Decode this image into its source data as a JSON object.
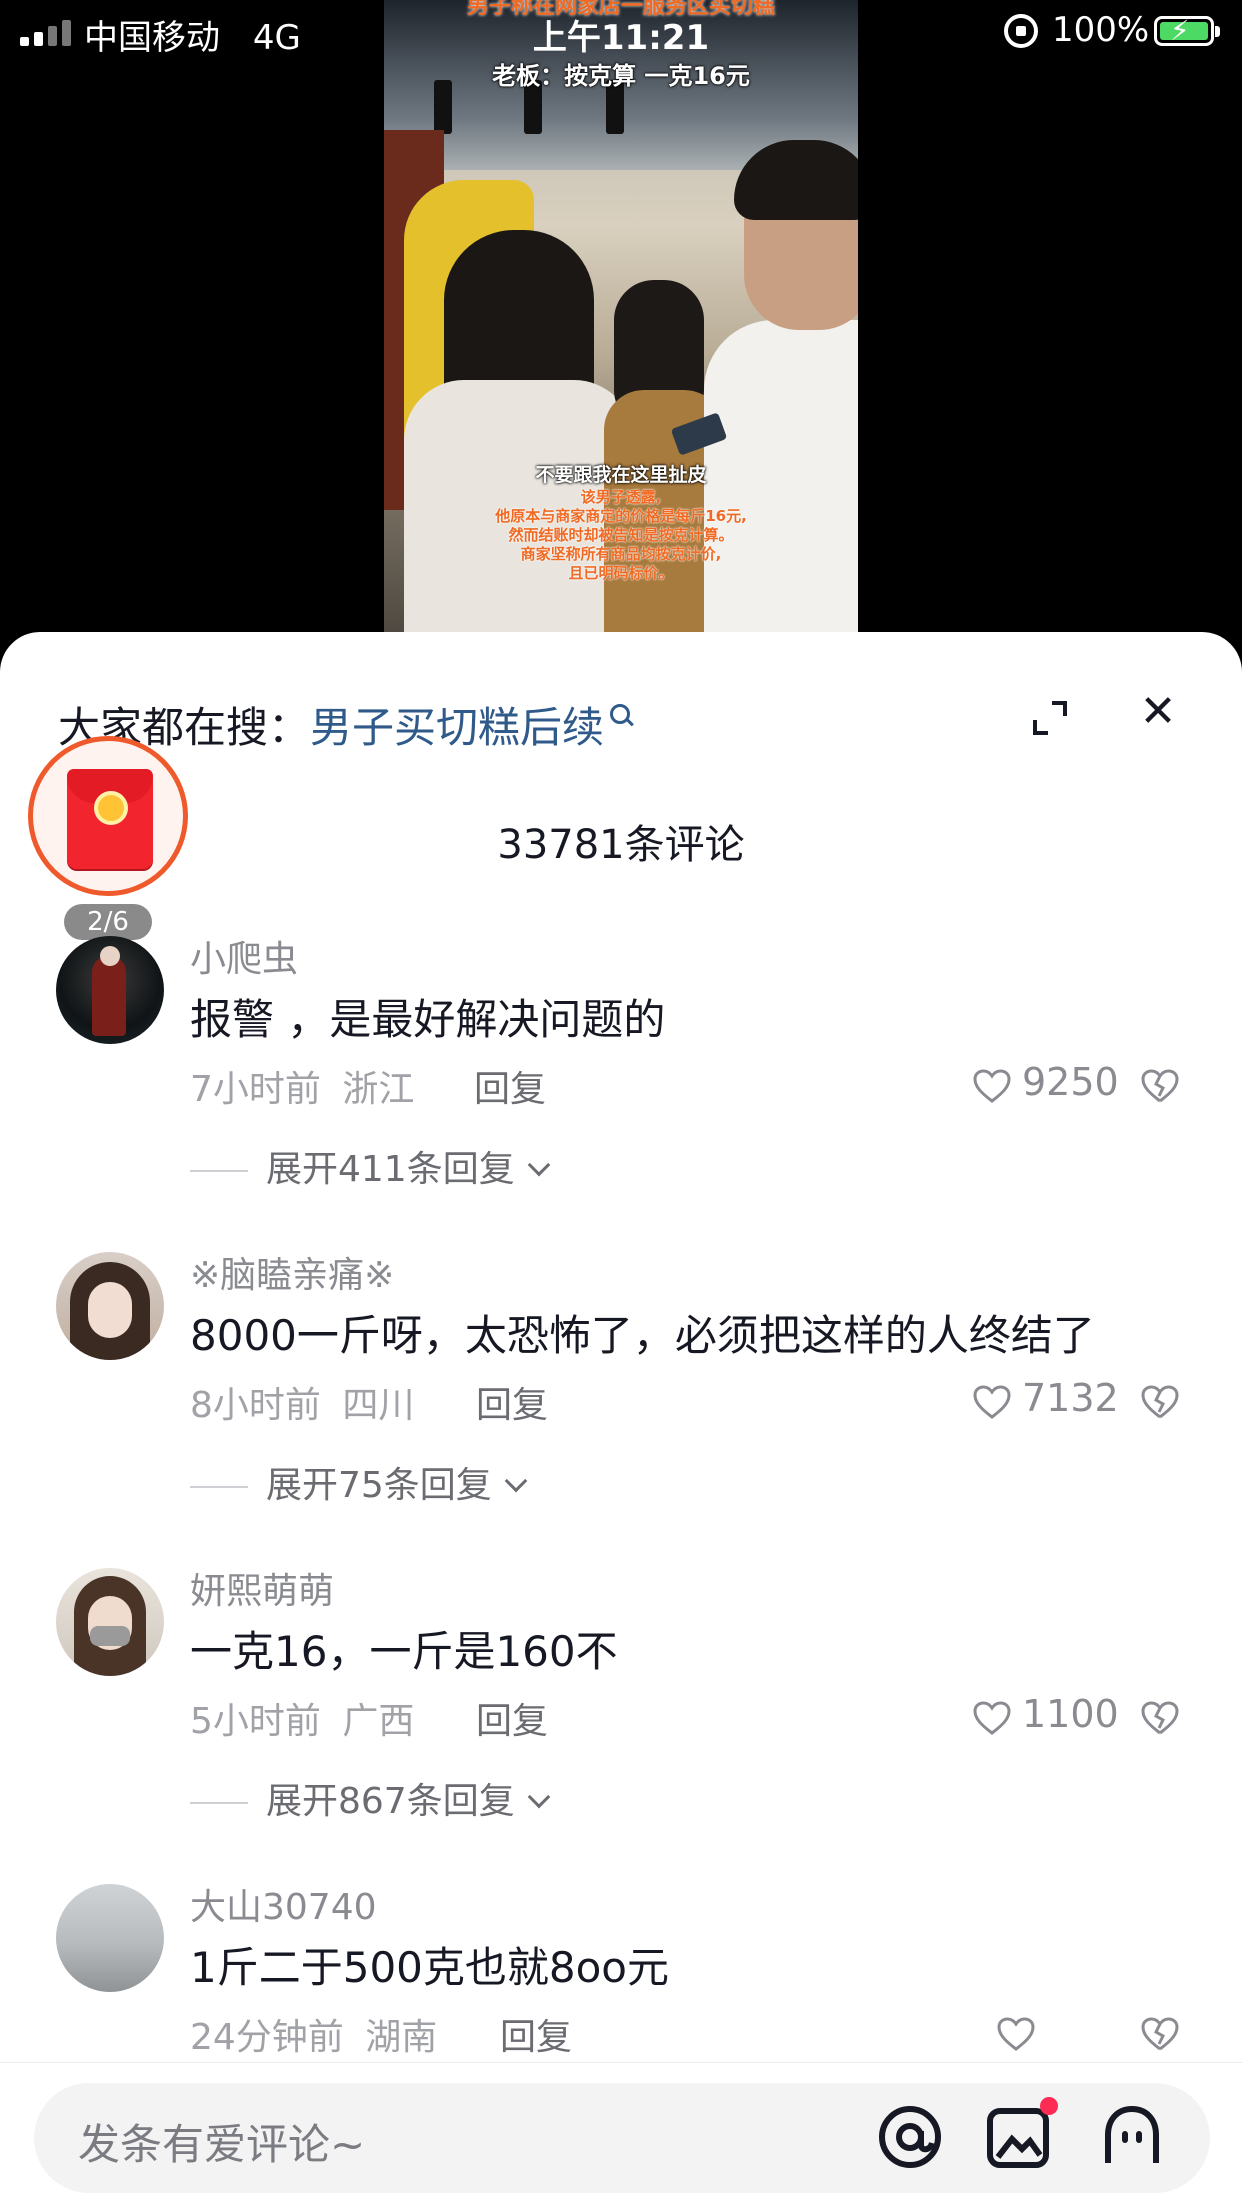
{
  "status_bar": {
    "carrier": "中国移动",
    "network": "4G",
    "time": "上午11:21",
    "battery": "100%"
  },
  "video": {
    "caption_top": "男子称在网家店一服务区买切糕",
    "caption_line2": "老板：按克算 一克16元",
    "caption_mid": "不要跟我在这里扯皮",
    "caption_sub": [
      "该男子透露,",
      "他原本与商家商定的价格是每斤16元,",
      "然而结账时却被告知是按克计算。",
      "商家坚称所有商品均按克计价,",
      "且已明码标价。"
    ]
  },
  "sheet": {
    "search_prefix": "大家都在搜：",
    "search_query": "男子买切糕后续",
    "comment_count": "33781条评论",
    "redpacket_badge": "2/6"
  },
  "comments": [
    {
      "username": "小爬虫",
      "content": "报警 ，是最好解决问题的",
      "time": "7小时前",
      "location": "浙江",
      "reply": "回复",
      "likes": "9250",
      "expand": "展开411条回复"
    },
    {
      "username": "※脑瞌亲痛※",
      "content": "8000一斤呀，太恐怖了，必须把这样的人终结了",
      "time": "8小时前",
      "location": "四川",
      "reply": "回复",
      "likes": "7132",
      "expand": "展开75条回复"
    },
    {
      "username": "妍熙萌萌",
      "content": "一克16，一斤是160不",
      "time": "5小时前",
      "location": "广西",
      "reply": "回复",
      "likes": "1100",
      "expand": "展开867条回复"
    },
    {
      "username": "大山30740",
      "content": "1斤二于500克也就8oo元",
      "time": "24分钟前",
      "location": "湖南",
      "reply": "回复",
      "likes": "",
      "expand": ""
    }
  ],
  "input": {
    "placeholder": "发条有爱评论~"
  },
  "colors": {
    "accent_red": "#fe2c55",
    "link_blue": "#2f5a8a",
    "battery_green": "#4cd964"
  }
}
